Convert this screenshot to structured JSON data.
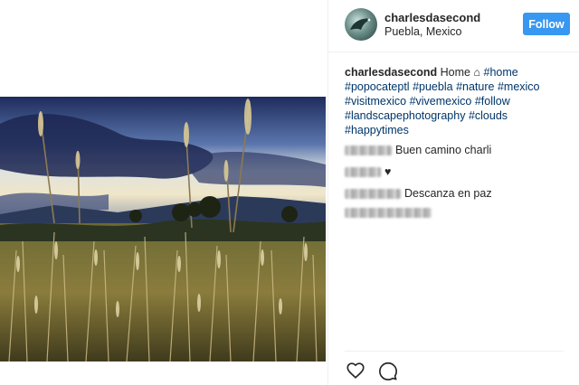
{
  "post": {
    "username": "charlesdasecond",
    "location": "Puebla, Mexico",
    "follow_label": "Follow"
  },
  "caption": {
    "username": "charlesdasecond",
    "text_prefix": "Home",
    "home_glyph": "⌂",
    "hashtags_line1": [
      "#home"
    ],
    "hashtags_line2": [
      "#popocateptl",
      "#puebla",
      "#nature",
      "#mexico"
    ],
    "hashtags_line3": [
      "#visitmexico",
      "#vivemexico",
      "#follow"
    ],
    "hashtags_line4": [
      "#landscapephotography",
      "#clouds",
      "#happytimes"
    ]
  },
  "comments": [
    {
      "text": "Buen camino charli"
    },
    {
      "text": "♥"
    },
    {
      "text": "Descanza en paz"
    },
    {
      "text": ""
    }
  ],
  "icons": {
    "like": "heart-icon",
    "comment": "comment-bubble-icon"
  },
  "colors": {
    "follow_bg": "#3897f0",
    "hashtag": "#003569",
    "text": "#262626",
    "border": "#efefef"
  }
}
